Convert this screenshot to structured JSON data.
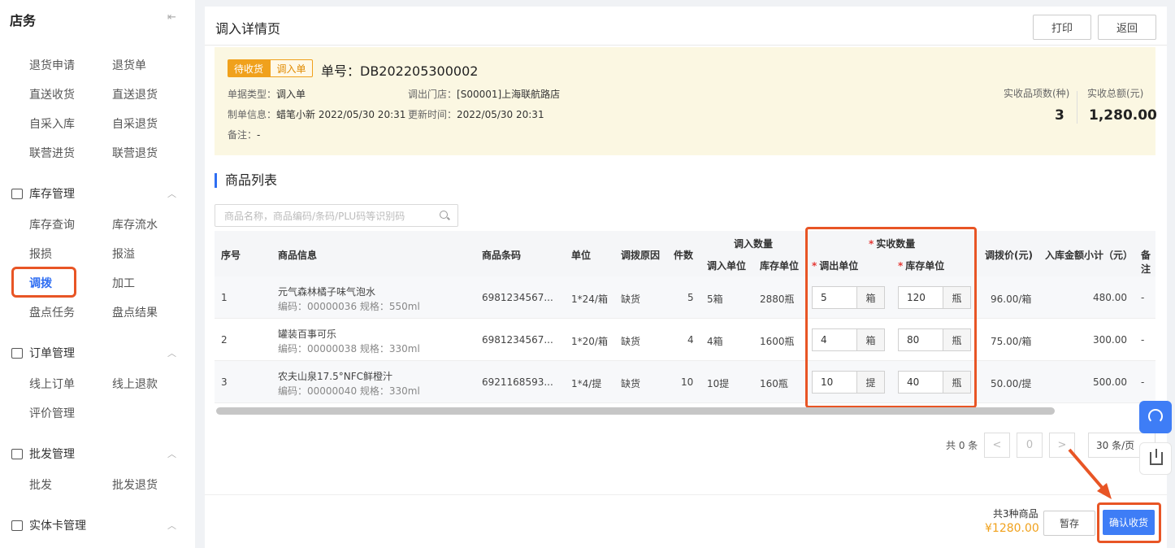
{
  "sidebar": {
    "title": "店务",
    "top_items": [
      "退货申请",
      "退货单",
      "直送收货",
      "直送退货",
      "自采入库",
      "自采退货",
      "联营进货",
      "联营退货"
    ],
    "groups": [
      {
        "label": "库存管理",
        "items": [
          "库存查询",
          "库存流水",
          "报损",
          "报溢",
          "调拨",
          "加工",
          "盘点任务",
          "盘点结果"
        ]
      },
      {
        "label": "订单管理",
        "items": [
          "线上订单",
          "线上退款",
          "评价管理"
        ]
      },
      {
        "label": "批发管理",
        "items": [
          "批发",
          "批发退货"
        ]
      },
      {
        "label": "实体卡管理"
      }
    ],
    "active_item": "调拨",
    "collapse_glyph": "⇤",
    "chevron_glyph": "︿"
  },
  "header": {
    "title": "调入详情页",
    "print_label": "打印",
    "back_label": "返回"
  },
  "info": {
    "status_tag": "待收货",
    "type_tag": "调入单",
    "order_no": "单号：DB202205300002",
    "doc_type_label": "单据类型：",
    "doc_type": "调入单",
    "from_store_label": "调出门店：",
    "from_store": "[S00001]上海联航路店",
    "creator_label": "制单信息：",
    "creator": "蜡笔小新 2022/05/30 20:31",
    "updated_label": "更新时间：",
    "updated": "2022/05/30 20:31",
    "remark_label": "备注：",
    "remark": "-",
    "items_count_label": "实收品项数(种)",
    "items_count": "3",
    "total_amount_label": "实收总额(元)",
    "total_amount": "1,280.00"
  },
  "section_title": "商品列表",
  "search": {
    "placeholder": "商品名称，商品编码/条码/PLU码等识别码"
  },
  "table": {
    "headers": {
      "seq": "序号",
      "info": "商品信息",
      "barcode": "商品条码",
      "unit": "单位",
      "reason": "调拨原因",
      "pieces": "件数",
      "in_qty": "调入数量",
      "in_unit": "调入单位",
      "stock_unit": "库存单位",
      "actual_qty": "实收数量",
      "out_unit": "调出单位",
      "actual_stock_unit": "库存单位",
      "price": "调拨价(元)",
      "subtotal": "入库金额小计（元）",
      "remark": "备注"
    },
    "required_mark": "*",
    "rows": [
      {
        "seq": "1",
        "name": "元气森林橘子味气泡水",
        "sub": "编码：00000036  规格：550ml",
        "barcode": "6981234567...",
        "unit": "1*24/箱",
        "reason": "缺货",
        "pieces": "5",
        "in_unit": "5箱",
        "stock_unit": "2880瓶",
        "out_val": "5",
        "out_u": "箱",
        "stk_val": "120",
        "stk_u": "瓶",
        "price": "96.00/箱",
        "subtotal": "480.00",
        "remark": "-"
      },
      {
        "seq": "2",
        "name": "罐装百事可乐",
        "sub": "编码：00000038  规格：330ml",
        "barcode": "6981234567...",
        "unit": "1*20/箱",
        "reason": "缺货",
        "pieces": "4",
        "in_unit": "4箱",
        "stock_unit": "1600瓶",
        "out_val": "4",
        "out_u": "箱",
        "stk_val": "80",
        "stk_u": "瓶",
        "price": "75.00/箱",
        "subtotal": "300.00",
        "remark": "-"
      },
      {
        "seq": "3",
        "name": "农夫山泉17.5°NFC鲜橙汁",
        "sub": "编码：00000040  规格：330ml",
        "barcode": "6921168593...",
        "unit": "1*4/提",
        "reason": "缺货",
        "pieces": "10",
        "in_unit": "10提",
        "stock_unit": "160瓶",
        "out_val": "10",
        "out_u": "提",
        "stk_val": "40",
        "stk_u": "瓶",
        "price": "50.00/提",
        "subtotal": "500.00",
        "remark": "-"
      }
    ]
  },
  "pagination": {
    "total": "共 0 条",
    "prev": "<",
    "page": "0",
    "next": ">",
    "size": "30 条/页"
  },
  "footer": {
    "count": "共3种商品",
    "total": "¥1280.00",
    "save_label": "暂存",
    "confirm_label": "确认收货"
  }
}
